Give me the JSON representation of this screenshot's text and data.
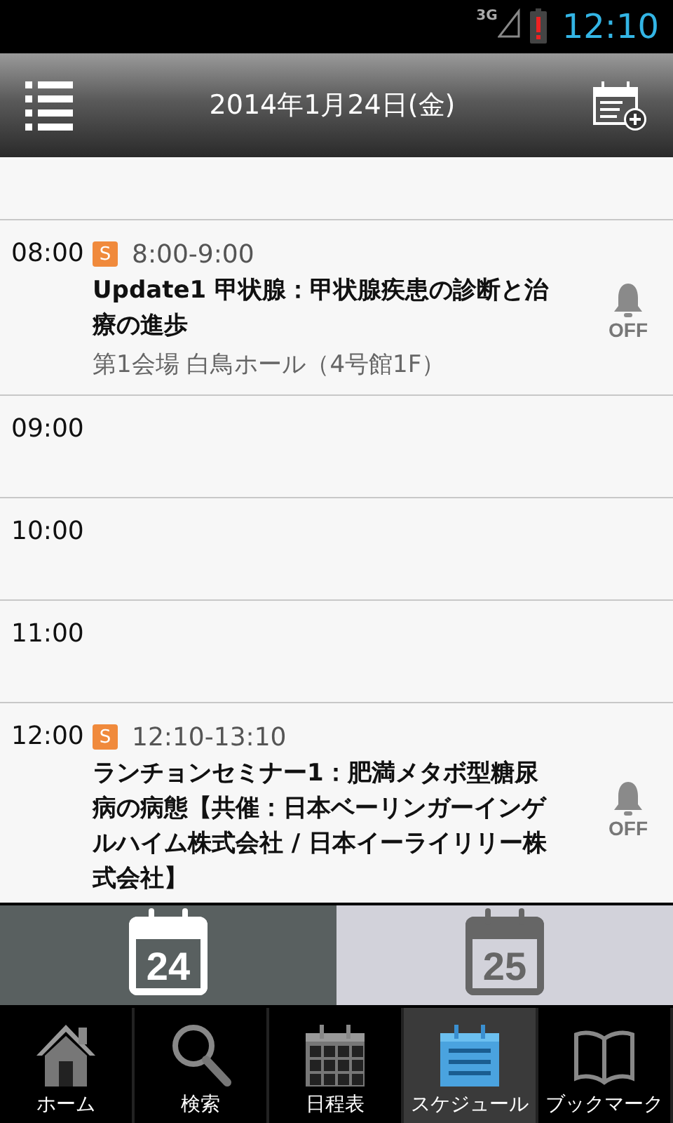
{
  "status_bar": {
    "network": "3G",
    "time": "12:10"
  },
  "header": {
    "title": "2014年1月24日(金)"
  },
  "slots": [
    {
      "time": "08:00",
      "events": [
        {
          "badge": "S",
          "range": "8:00-9:00",
          "title": "Update1 甲状腺：甲状腺疾患の診断と治療の進歩",
          "location": "第1会場 白鳥ホール（4号館1F）",
          "alarm": "OFF"
        }
      ]
    },
    {
      "time": "09:00"
    },
    {
      "time": "10:00"
    },
    {
      "time": "11:00"
    },
    {
      "time": "12:00",
      "events": [
        {
          "badge": "S",
          "range": "12:10-13:10",
          "title": "ランチョンセミナー1：肥満メタボ型糖尿病の病態【共催：日本ベーリンガーインゲルハイム株式会社 / 日本イーライリリー株式会社】",
          "alarm": "OFF"
        }
      ]
    }
  ],
  "day_tabs": [
    {
      "day": "24",
      "selected": true
    },
    {
      "day": "25",
      "selected": false
    }
  ],
  "nav": [
    {
      "kind": "home",
      "label": "ホーム",
      "selected": false
    },
    {
      "kind": "search",
      "label": "検索",
      "selected": false
    },
    {
      "kind": "grid",
      "label": "日程表",
      "selected": false
    },
    {
      "kind": "schedule",
      "label": "スケジュール",
      "selected": true
    },
    {
      "kind": "book",
      "label": "ブックマーク",
      "selected": false
    }
  ]
}
